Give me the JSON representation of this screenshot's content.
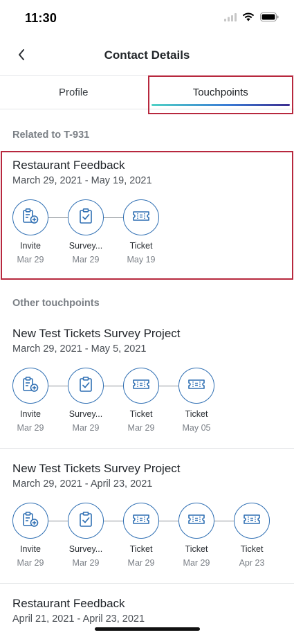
{
  "status_bar": {
    "time": "11:30"
  },
  "nav": {
    "title": "Contact Details"
  },
  "tabs": [
    {
      "label": "Profile",
      "active": false
    },
    {
      "label": "Touchpoints",
      "active": true
    }
  ],
  "sections": {
    "related_header": "Related to T-931",
    "other_header": "Other touchpoints"
  },
  "projects": [
    {
      "title": "Restaurant Feedback",
      "dates": "March 29, 2021 - May 19, 2021",
      "steps": [
        {
          "icon": "invite-icon",
          "label": "Invite",
          "date": "Mar 29"
        },
        {
          "icon": "survey-icon",
          "label": "Survey...",
          "date": "Mar 29"
        },
        {
          "icon": "ticket-icon",
          "label": "Ticket",
          "date": "May 19"
        }
      ]
    },
    {
      "title": "New Test Tickets Survey Project",
      "dates": "March 29, 2021 - May 5, 2021",
      "steps": [
        {
          "icon": "invite-icon",
          "label": "Invite",
          "date": "Mar 29"
        },
        {
          "icon": "survey-icon",
          "label": "Survey...",
          "date": "Mar 29"
        },
        {
          "icon": "ticket-icon",
          "label": "Ticket",
          "date": "Mar 29"
        },
        {
          "icon": "ticket-icon",
          "label": "Ticket",
          "date": "May 05"
        }
      ]
    },
    {
      "title": "New Test Tickets Survey Project",
      "dates": "March 29, 2021 - April 23, 2021",
      "steps": [
        {
          "icon": "invite-icon",
          "label": "Invite",
          "date": "Mar 29"
        },
        {
          "icon": "survey-icon",
          "label": "Survey...",
          "date": "Mar 29"
        },
        {
          "icon": "ticket-icon",
          "label": "Ticket",
          "date": "Mar 29"
        },
        {
          "icon": "ticket-icon",
          "label": "Ticket",
          "date": "Mar 29"
        },
        {
          "icon": "ticket-icon",
          "label": "Ticket",
          "date": "Apr 23"
        }
      ]
    },
    {
      "title": "Restaurant Feedback",
      "dates": "April 21, 2021 - April 23, 2021",
      "steps": []
    }
  ],
  "colors": {
    "accent": "#2f6fb3",
    "highlight": "#b7283e"
  }
}
